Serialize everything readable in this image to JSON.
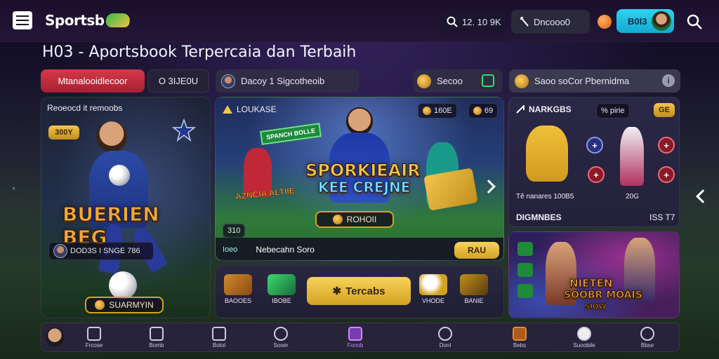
{
  "header": {
    "logo_text": "Sportsb",
    "search_value": "12. 10 9K",
    "code_value": "Dncooo0",
    "login_label": "B0I3"
  },
  "page": {
    "title": "H03 - Aportsbook Terpercaia dan Terbaih"
  },
  "tabs": {
    "primary_label": "Mtanalooidlecoor",
    "secondary_label": "O 3IJE0U",
    "user_pill_label": "Dacoy 1 Sigcotheoib",
    "mid_pill_label": "Secoo",
    "search_pill_label": "Saoo soCor Pbernidma"
  },
  "left_card": {
    "header_label": "Reoeocd it remoobs",
    "badge_label": "300Y",
    "hero_title": "BUERIEN BEG",
    "player_line": "DOD3S I SNGE 786",
    "cta_label": "SUARMYIN"
  },
  "center_card": {
    "header_label": "LOUKASE",
    "badge_one": "160E",
    "badge_two": "69",
    "banner_small": "SPANCH BOLLE",
    "banner_tilt": "AZNCIA ALTIIE",
    "hero_line1": "SPORKIEAIR",
    "hero_line2": "KEE CREJNE",
    "mini_count": "310",
    "mid_button": "ROHOII",
    "footer_label": "Ioeo",
    "footer_text": "Nebecahn Soro",
    "footer_button": "RAU"
  },
  "right_top": {
    "header_label": "NARKGBS",
    "badge_one": "% pirie",
    "badge_two": "GE",
    "caption": "Tê nanares 100B5",
    "caption_right": "20G",
    "footer_left": "DIGMNBES",
    "footer_right": "ISS T7"
  },
  "right_bottom": {
    "hero_line1": "NIETEN",
    "hero_line2": "SOOBR MOAIS",
    "hero_line3": "SIOW"
  },
  "strip": {
    "items": [
      {
        "label": "BAOOES"
      },
      {
        "label": "IBOBE"
      },
      {
        "label": "VHODE"
      },
      {
        "label": "BANIE"
      }
    ],
    "main_button": "Tercabs"
  },
  "bottom_nav": {
    "items": [
      {
        "label": "Frcose"
      },
      {
        "label": "Bomb"
      },
      {
        "label": "Botol"
      },
      {
        "label": "Sooer"
      },
      {
        "label": "Fonob"
      },
      {
        "label": "Donl"
      },
      {
        "label": "Bebs"
      },
      {
        "label": "Suoobile"
      },
      {
        "label": "Bbse"
      }
    ]
  },
  "colors": {
    "accent_red": "#d33a48",
    "accent_cyan": "#2bd4f0",
    "accent_gold": "#f3c54a",
    "bg": "#0d0a1a"
  }
}
